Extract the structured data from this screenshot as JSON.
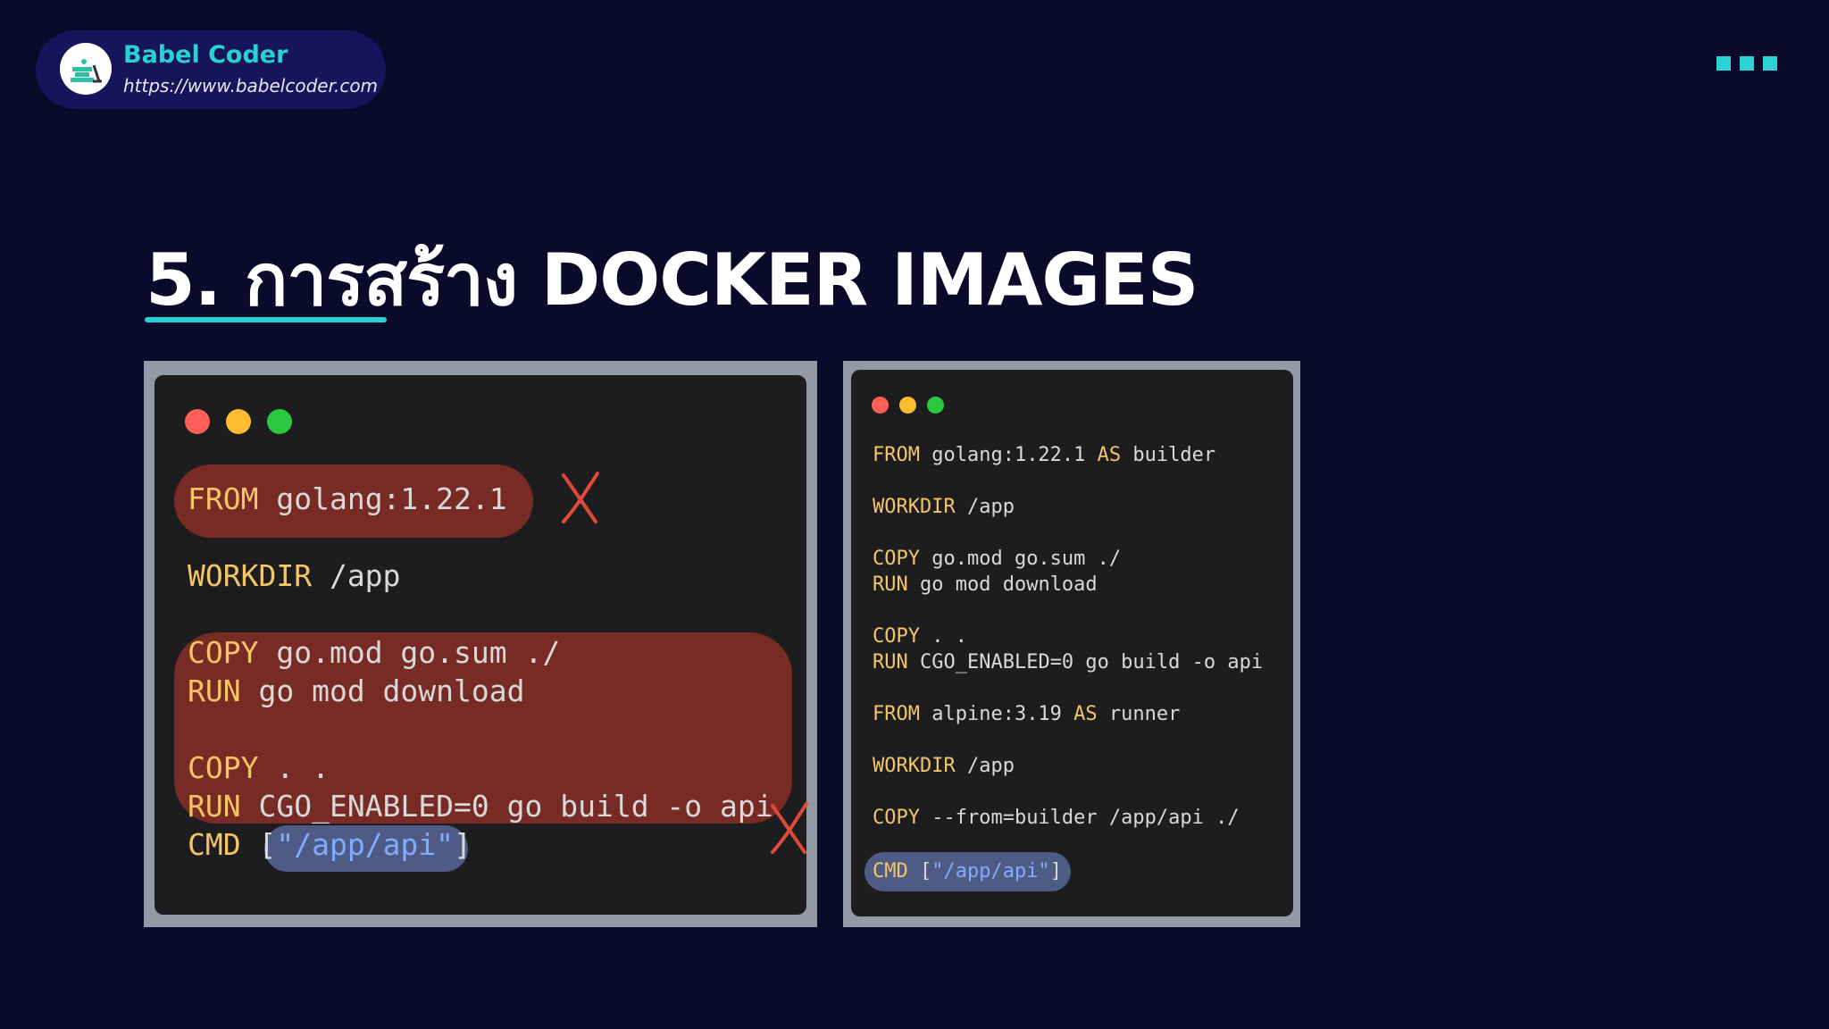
{
  "brand": {
    "name": "Babel Coder",
    "url": "https://www.babelcoder.com"
  },
  "title": "5. การสร้าง DOCKER IMAGES",
  "colors": {
    "background": "#0c0a2b",
    "accent": "#28d2d3",
    "keyword": "#f3c567",
    "string": "#82aaff",
    "highlight_red": "#782b24",
    "highlight_blue": "#4d5b85"
  },
  "left_code": {
    "line1": {
      "kw": "FROM",
      "rest": " golang:1.22.1"
    },
    "line2": {
      "kw": "WORKDIR",
      "rest": " /app"
    },
    "line3": {
      "kw": "COPY",
      "rest": " go.mod go.sum ./"
    },
    "line4": {
      "kw": "RUN",
      "rest": " go mod download"
    },
    "line5": {
      "kw": "COPY",
      "rest": " . ."
    },
    "line6": {
      "kw": "RUN",
      "rest": " CGO_ENABLED=0 go build -o api"
    },
    "line7": {
      "kw": "CMD",
      "pre": " [",
      "str": "\"/app/api\"",
      "post": "]"
    }
  },
  "right_code": {
    "line1": {
      "kw": "FROM",
      "rest": " golang:1.22.1 ",
      "kw2": "AS",
      "rest2": " builder"
    },
    "line2": {
      "kw": "WORKDIR",
      "rest": " /app"
    },
    "line3": {
      "kw": "COPY",
      "rest": " go.mod go.sum ./"
    },
    "line4": {
      "kw": "RUN",
      "rest": " go mod download"
    },
    "line5": {
      "kw": "COPY",
      "rest": " . ."
    },
    "line6": {
      "kw": "RUN",
      "rest": " CGO_ENABLED=0 go build -o api"
    },
    "line7": {
      "kw": "FROM",
      "rest": " alpine:3.19 ",
      "kw2": "AS",
      "rest2": " runner"
    },
    "line8": {
      "kw": "WORKDIR",
      "rest": " /app"
    },
    "line9": {
      "kw": "COPY",
      "rest": " --from=builder /app/api ./"
    },
    "line10": {
      "kw": "CMD",
      "pre": " [",
      "str": "\"/app/api\"",
      "post": "]"
    }
  }
}
